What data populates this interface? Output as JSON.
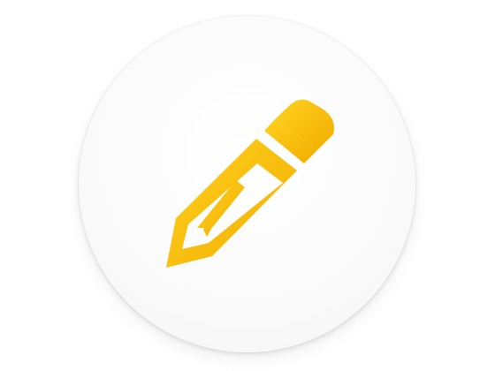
{
  "app_icon": {
    "icon_name": "pencil-icon",
    "disc_color": "#fbfbfb",
    "accent_color": "#f6b800"
  }
}
